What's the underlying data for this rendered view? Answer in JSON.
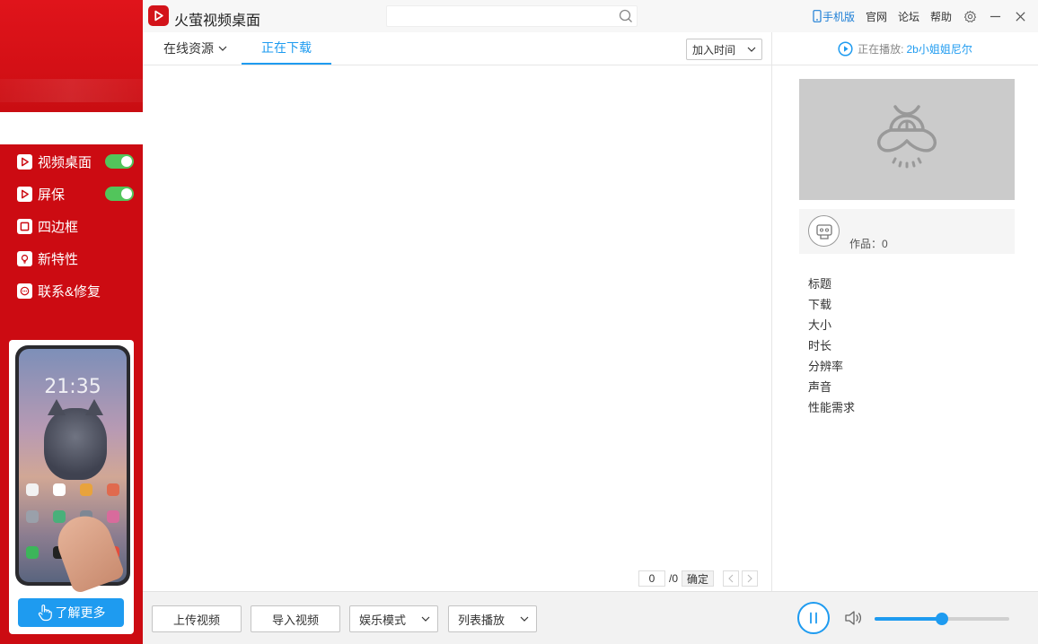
{
  "app": {
    "title": "火萤视频桌面"
  },
  "titlebar": {
    "search_value": "",
    "links": {
      "mobile": "手机版",
      "official": "官网",
      "forum": "论坛",
      "help": "帮助"
    }
  },
  "sidebar": {
    "items": [
      {
        "label": "视频桌面",
        "icon": "play-icon",
        "toggle": true
      },
      {
        "label": "屏保",
        "icon": "play-icon",
        "toggle": true
      },
      {
        "label": "四边框",
        "icon": "frame-icon"
      },
      {
        "label": "新特性",
        "icon": "bulb-icon"
      },
      {
        "label": "联系&修复",
        "icon": "chat-icon"
      }
    ],
    "promo": {
      "phone_time": "21:35",
      "button_label": "了解更多"
    }
  },
  "tabs": {
    "online": "在线资源",
    "downloading": "正在下载",
    "sort_value": "加入时间"
  },
  "pager": {
    "current": "0",
    "total": "/0",
    "confirm": "确定"
  },
  "right_panel": {
    "now_playing_label": "正在播放:",
    "now_playing_title": "2b小姐姐尼尔",
    "works_label": "作品：0",
    "info": [
      "标题",
      "下载",
      "大小",
      "时长",
      "分辨率",
      "声音",
      "性能需求"
    ]
  },
  "bottom": {
    "upload": "上传视频",
    "import": "导入视频",
    "mode": "娱乐模式",
    "playlist": "列表播放",
    "volume": 0.5
  },
  "colors": {
    "brand_red": "#cc0b12",
    "accent_blue": "#1e9bf0",
    "toggle_green": "#52c55b"
  }
}
